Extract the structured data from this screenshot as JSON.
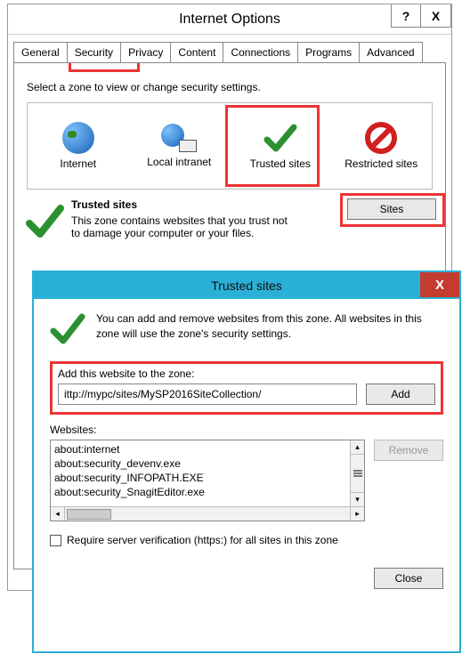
{
  "io": {
    "title": "Internet Options",
    "tabs": [
      "General",
      "Security",
      "Privacy",
      "Content",
      "Connections",
      "Programs",
      "Advanced"
    ],
    "active_tab": 1,
    "zone_prompt": "Select a zone to view or change security settings.",
    "zones": [
      "Internet",
      "Local intranet",
      "Trusted sites",
      "Restricted sites"
    ],
    "selected_zone": 2,
    "desc_title": "Trusted sites",
    "desc_body": "This zone contains websites that you trust not to damage your computer or your files.",
    "sites_btn": "Sites"
  },
  "ts": {
    "title": "Trusted sites",
    "desc": "You can add and remove websites from this zone. All websites in this zone will use the zone's security settings.",
    "add_label": "Add this website to the zone:",
    "add_value": "ittp://mypc/sites/MySP2016SiteCollection/",
    "add_btn": "Add",
    "websites_label": "Websites:",
    "websites": [
      "about:internet",
      "about:security_devenv.exe",
      "about:security_INFOPATH.EXE",
      "about:security_SnagitEditor.exe"
    ],
    "remove_btn": "Remove",
    "require_label": "Require server verification (https:) for all sites in this zone",
    "close_btn": "Close"
  }
}
